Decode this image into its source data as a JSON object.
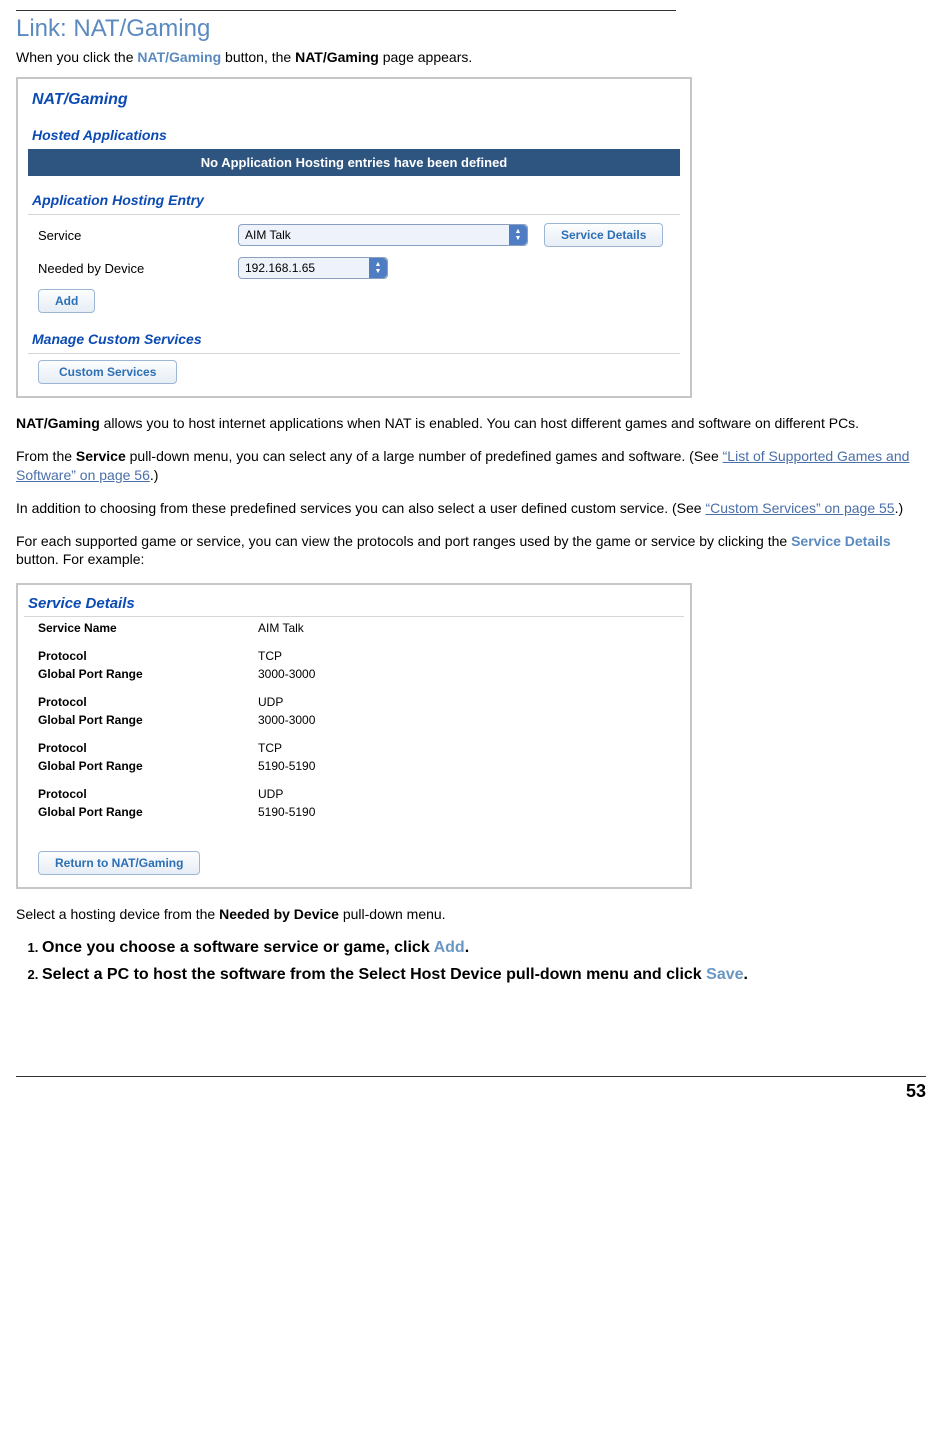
{
  "heading": "Link: NAT/Gaming",
  "intro": {
    "pre": "When you click the ",
    "btn": "NAT/Gaming",
    "mid": " button, the ",
    "page": "NAT/Gaming",
    "post": " page appears."
  },
  "panel1": {
    "title": "NAT/Gaming",
    "hosted_heading": "Hosted Applications",
    "hosted_msg": "No Application Hosting entries have been defined",
    "entry_heading": "Application Hosting Entry",
    "service_label": "Service",
    "service_value": "AIM Talk",
    "service_details_btn": "Service Details",
    "device_label": "Needed by Device",
    "device_value": "192.168.1.65",
    "add_btn": "Add",
    "manage_heading": "Manage Custom Services",
    "custom_btn": "Custom Services"
  },
  "para1": {
    "boldlead": "NAT/Gaming",
    "rest": " allows you to host internet applications when NAT is enabled. You can host different games and software on different PCs."
  },
  "para2": {
    "pre": "From the ",
    "b1": "Service",
    "mid": " pull-down menu, you can select any of a large number of predefined games and software. (See ",
    "link": "“List of Supported Games and Software” on page 56",
    "post": ".)"
  },
  "para3": {
    "pre": "In addition to choosing from these predefined services you can also select a user defined custom service. (See ",
    "link": "“Custom Services” on page 55",
    "post": ".)"
  },
  "para4": {
    "pre": "For each supported game or service, you can view the protocols and port ranges used by the game or service by clicking the ",
    "btn": "Service Details",
    "post": " button. For example:"
  },
  "panel2": {
    "title": "Service Details",
    "name_label": "Service Name",
    "name_value": "AIM Talk",
    "groups": [
      {
        "protocol_label": "Protocol",
        "protocol_value": "TCP",
        "range_label": "Global Port Range",
        "range_value": "3000-3000"
      },
      {
        "protocol_label": "Protocol",
        "protocol_value": "UDP",
        "range_label": "Global Port Range",
        "range_value": "3000-3000"
      },
      {
        "protocol_label": "Protocol",
        "protocol_value": "TCP",
        "range_label": "Global Port Range",
        "range_value": "5190-5190"
      },
      {
        "protocol_label": "Protocol",
        "protocol_value": "UDP",
        "range_label": "Global Port Range",
        "range_value": "5190-5190"
      }
    ],
    "return_btn": "Return to NAT/Gaming"
  },
  "select_line": {
    "pre": "Select a hosting device from the ",
    "b": "Needed by Device",
    "post": " pull-down menu."
  },
  "steps": {
    "s1_pre": "Once you choose a software service or game, click ",
    "s1_kw": "Add",
    "s1_post": ".",
    "s2_pre": "Select a PC to host the software from the Select Host Device pull-down menu and click ",
    "s2_kw": "Save",
    "s2_post": "."
  },
  "page_number": "53"
}
